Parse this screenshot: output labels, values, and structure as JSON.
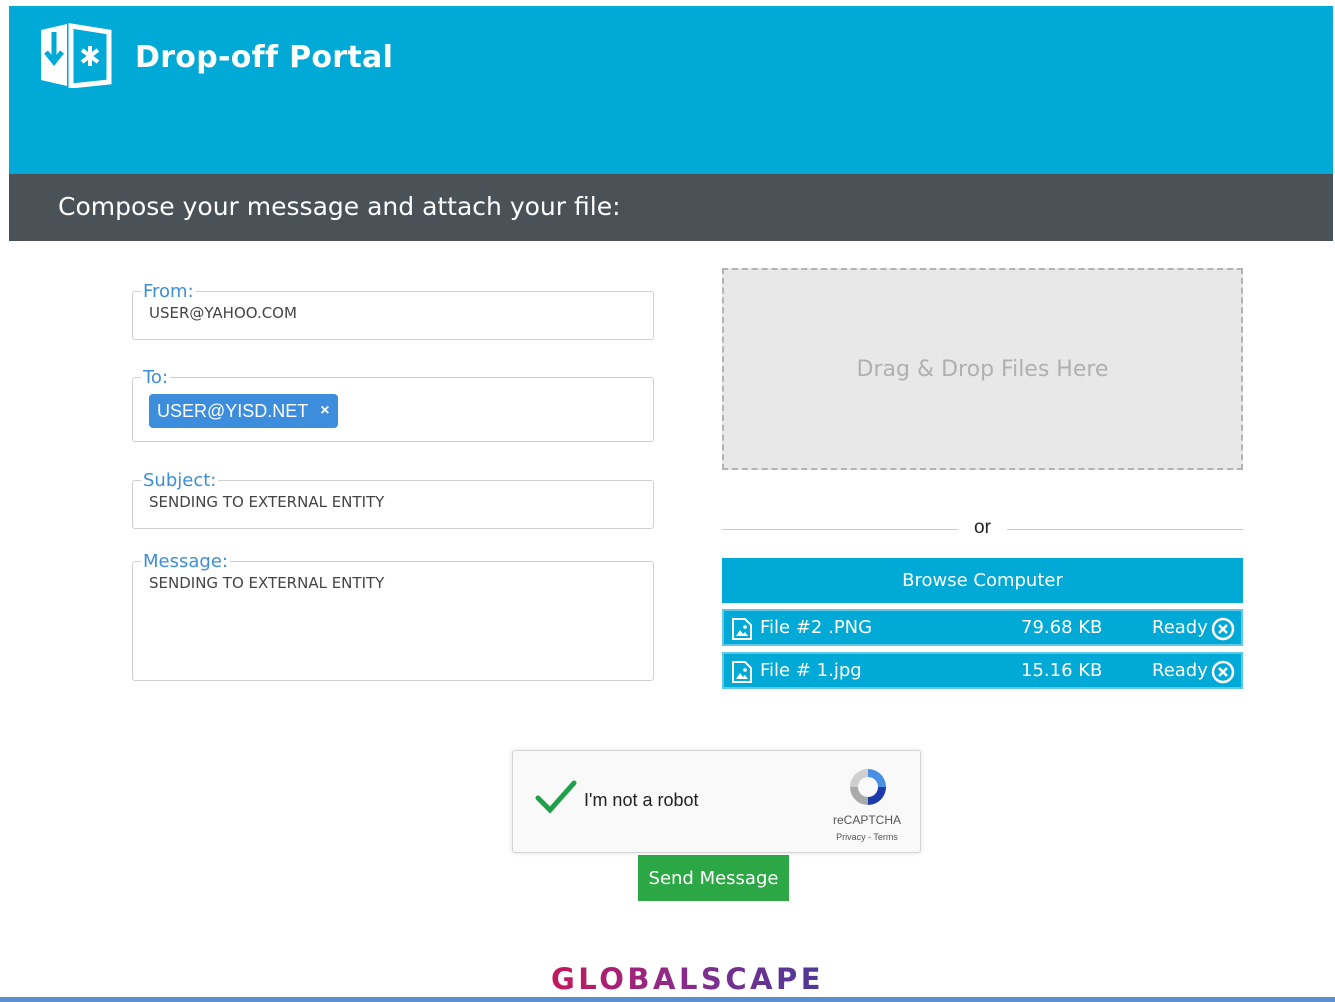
{
  "header": {
    "brand": "Drop-off Portal",
    "logo_icon": "dropbox-upload-icon",
    "bg_color": "#00a9d6"
  },
  "subbar": {
    "title": "Compose your message and attach your file:",
    "bg_color": "#4a5157"
  },
  "form": {
    "from": {
      "label": "From:",
      "value": "USER@YAHOO.COM"
    },
    "to": {
      "label": "To:",
      "recipients": [
        {
          "email": "USER@YISD.NET",
          "remove": "×"
        }
      ]
    },
    "subject": {
      "label": "Subject:",
      "value": "SENDING TO EXTERNAL ENTITY"
    },
    "message": {
      "label": "Message:",
      "value": "SENDING TO EXTERNAL ENTITY"
    }
  },
  "upload": {
    "dropzone_text": "Drag & Drop Files Here",
    "or_text": "or",
    "browse_label": "Browse Computer",
    "files": [
      {
        "name": "File #2 .PNG",
        "size": "79.68 KB",
        "status": "Ready"
      },
      {
        "name": "File # 1.jpg",
        "size": "15.16 KB",
        "status": "Ready"
      }
    ]
  },
  "captcha": {
    "label": "I'm not a robot",
    "checked": true,
    "brand": "reCAPTCHA",
    "links": "Privacy - Terms"
  },
  "send_label": "Send Message",
  "footer": {
    "logo_text": "GLOBALSCAPE"
  },
  "colors": {
    "accent": "#00a9d6",
    "send": "#2ca745",
    "tag": "#3c8ddc",
    "label": "#3d8ed6"
  }
}
